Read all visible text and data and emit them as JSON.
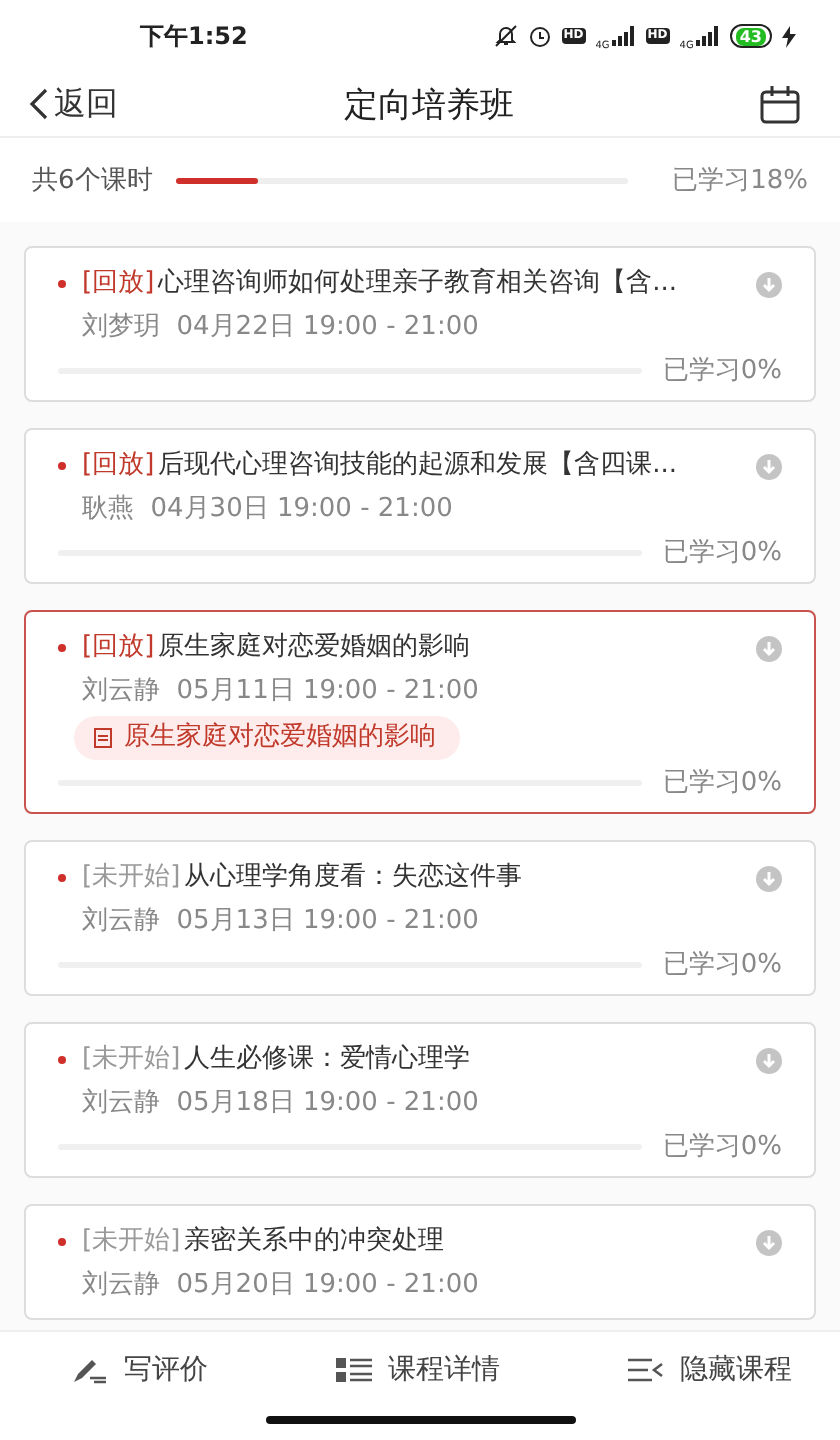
{
  "status_bar": {
    "time": "下午1:52",
    "network_labels": [
      "HD",
      "4G",
      "HD",
      "4G"
    ],
    "battery": "43"
  },
  "nav": {
    "back": "返回",
    "title": "定向培养班"
  },
  "summary": {
    "count": "共6个课时",
    "level": 0.18,
    "reading": "已学习18%"
  },
  "lessons": [
    {
      "kind": "replay",
      "tag": "[回放]",
      "title": "心理咨询师如何处理亲子教育相关咨询【含...",
      "teacher": "刘梦玥",
      "time": "04月22日 19:00 - 21:00",
      "level": 0,
      "reading": "已学习0%",
      "selected": false
    },
    {
      "kind": "replay",
      "tag": "[回放]",
      "title": "后现代心理咨询技能的起源和发展【含四课...",
      "teacher": "耿燕",
      "time": "04月30日 19:00 - 21:00",
      "level": 0,
      "reading": "已学习0%",
      "selected": false
    },
    {
      "kind": "replay",
      "tag": "[回放]",
      "title": "原生家庭对恋爱婚姻的影响",
      "teacher": "刘云静",
      "time": "05月11日 19:00 - 21:00",
      "note": "原生家庭对恋爱婚姻的影响",
      "level": 0,
      "reading": "已学习0%",
      "selected": true
    },
    {
      "kind": "upcoming",
      "tag": "[未开始]",
      "title": "从心理学角度看：失恋这件事",
      "teacher": "刘云静",
      "time": "05月13日 19:00 - 21:00",
      "level": 0,
      "reading": "已学习0%",
      "selected": false
    },
    {
      "kind": "upcoming",
      "tag": "[未开始]",
      "title": "人生必修课：爱情心理学",
      "teacher": "刘云静",
      "time": "05月18日 19:00 - 21:00",
      "level": 0,
      "reading": "已学习0%",
      "selected": false
    },
    {
      "kind": "upcoming",
      "tag": "[未开始]",
      "title": "亲密关系中的冲突处理",
      "teacher": "刘云静",
      "time": "05月20日 19:00 - 21:00",
      "selected": false
    }
  ],
  "bottom_bar": [
    {
      "kind": "review",
      "label": "写评价"
    },
    {
      "kind": "details",
      "label": "课程详情"
    },
    {
      "kind": "hide",
      "label": "隐藏课程"
    }
  ]
}
